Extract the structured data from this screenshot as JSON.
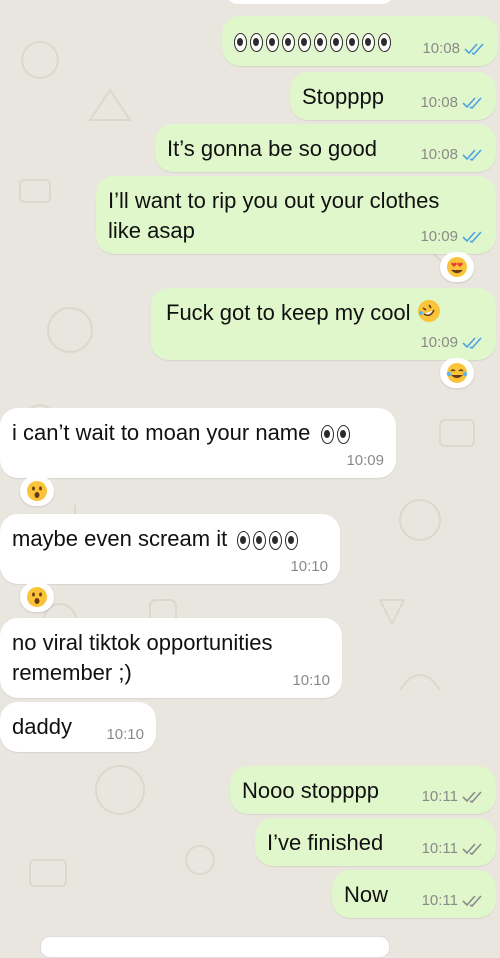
{
  "messages": [
    {
      "id": "m1",
      "dir": "out",
      "time": "10:08",
      "ticks": "read",
      "eyes": 10
    },
    {
      "id": "m2",
      "dir": "out",
      "text": "Stopppp",
      "time": "10:08",
      "ticks": "read"
    },
    {
      "id": "m3",
      "dir": "out",
      "text": "It’s gonna be so good",
      "time": "10:08",
      "ticks": "read"
    },
    {
      "id": "m4",
      "dir": "out",
      "line1": "I’ll want to rip you out your clothes",
      "line2": "like asap",
      "time": "10:09",
      "ticks": "read",
      "reaction": "heart-eyes-emoji"
    },
    {
      "id": "m5",
      "dir": "out",
      "text": "Fuck got to keep my cool",
      "time": "10:09",
      "ticks": "read",
      "emoji": "rofl-emoji",
      "reaction": "tears-of-joy-emoji"
    },
    {
      "id": "m6",
      "dir": "in",
      "text": "i can’t wait to moan your name",
      "time": "10:09",
      "eyes": 2,
      "reaction": "surprised-emoji"
    },
    {
      "id": "m7",
      "dir": "in",
      "text": "maybe even scream it",
      "time": "10:10",
      "eyes": 4,
      "reaction": "surprised-emoji"
    },
    {
      "id": "m8",
      "dir": "in",
      "line1": "no viral tiktok opportunities",
      "line2": "remember ;)",
      "time": "10:10"
    },
    {
      "id": "m9",
      "dir": "in",
      "text": "daddy",
      "time": "10:10"
    },
    {
      "id": "m10",
      "dir": "out",
      "text": "Nooo stopppp",
      "time": "10:11",
      "ticks": "delivered"
    },
    {
      "id": "m11",
      "dir": "out",
      "text": "I’ve finished",
      "time": "10:11",
      "ticks": "delivered"
    },
    {
      "id": "m12",
      "dir": "out",
      "text": "Now",
      "time": "10:11",
      "ticks": "delivered"
    }
  ],
  "colors": {
    "outgoing_bubble": "#e0f7cb",
    "incoming_bubble": "#ffffff",
    "wallpaper": "#e9e6df",
    "read_ticks": "#4fa3e0",
    "delivered_ticks": "#8a8a8a"
  }
}
